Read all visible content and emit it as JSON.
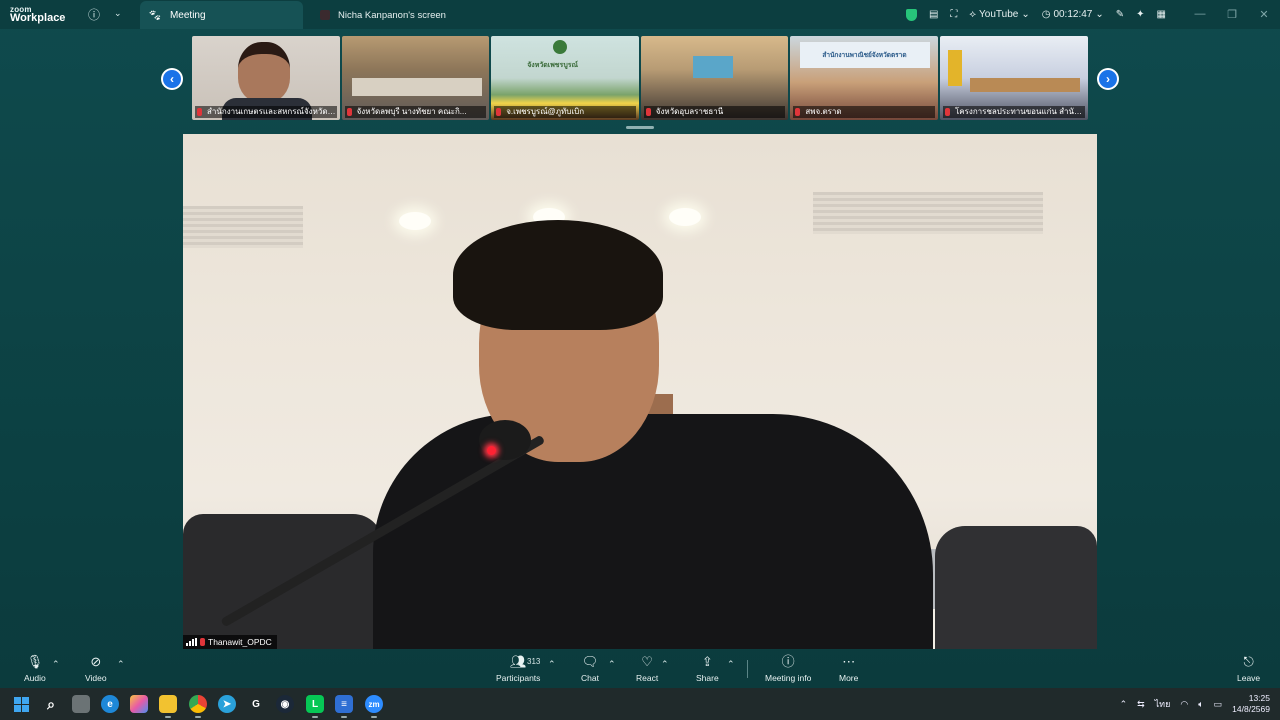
{
  "app": {
    "logo_line1": "zoom",
    "logo_line2": "Workplace",
    "tabs": [
      {
        "label": "Meeting"
      },
      {
        "label": "Nicha Kanpanon's screen"
      }
    ],
    "youtube_label": "YouTube",
    "timer": "00:12:47"
  },
  "gallery": {
    "tiles": [
      {
        "label": "สำนักงานเกษตรและสหกรณ์จังหวัดชั..."
      },
      {
        "label": "จังหวัดลพบุรี นางทัชยา คณะกิ..."
      },
      {
        "label": "จ.เพชรบูรณ์@ภูทับเบิก"
      },
      {
        "label": "จังหวัดอุบลราชธานี"
      },
      {
        "label": "สพจ.ตราด"
      },
      {
        "label": "โครงการชลประทานขอนแก่น สำนักงา..."
      }
    ],
    "tile3_banner": "จังหวัดเพชรบูรณ์",
    "tile5_banner": "สำนักงานพาณิชย์จังหวัดตราด"
  },
  "main_video": {
    "speaker_name": "Thanawit_OPDC"
  },
  "toolbar": {
    "audio": "Audio",
    "video": "Video",
    "participants": "Participants",
    "participants_count": "313",
    "chat": "Chat",
    "react": "React",
    "share": "Share",
    "meeting_info": "Meeting info",
    "more": "More",
    "leave": "Leave"
  },
  "taskbar": {
    "lang": "ไทย",
    "time": "13:25",
    "date": "14/8/2569"
  },
  "colors": {
    "background": "#0d4446",
    "accent_blue": "#1a73e8",
    "muted_red": "#e0353a",
    "shield_green": "#27c47a"
  }
}
